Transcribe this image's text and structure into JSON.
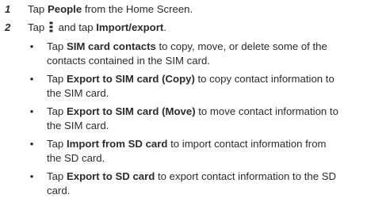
{
  "steps": [
    {
      "number": "1",
      "pre": "Tap ",
      "bold": "People",
      "post": " from the Home Screen."
    },
    {
      "number": "2",
      "pre": "Tap ",
      "icon": "more-options-vertical-icon",
      "mid": " and tap ",
      "bold": "Import/export",
      "post": "."
    }
  ],
  "bullets": [
    {
      "pre": "Tap ",
      "bold": "SIM card contacts",
      "post_line1": " to copy, move, or delete some of the",
      "line2": "contacts contained in the SIM card."
    },
    {
      "pre": "Tap ",
      "bold": "Export to SIM card (Copy)",
      "post_line1": " to copy contact information to",
      "line2": "the SIM card."
    },
    {
      "pre": "Tap ",
      "bold": "Export to SIM card (Move)",
      "post_line1": " to move contact information to",
      "line2": "the SIM card."
    },
    {
      "pre": "Tap ",
      "bold": "Import from SD card",
      "post_line1": " to import contact information from",
      "line2": "the SD card."
    },
    {
      "pre": "Tap ",
      "bold": "Export to SD card",
      "post_line1": " to export contact information to the SD",
      "line2": "card."
    }
  ],
  "bullet_symbol": "•"
}
